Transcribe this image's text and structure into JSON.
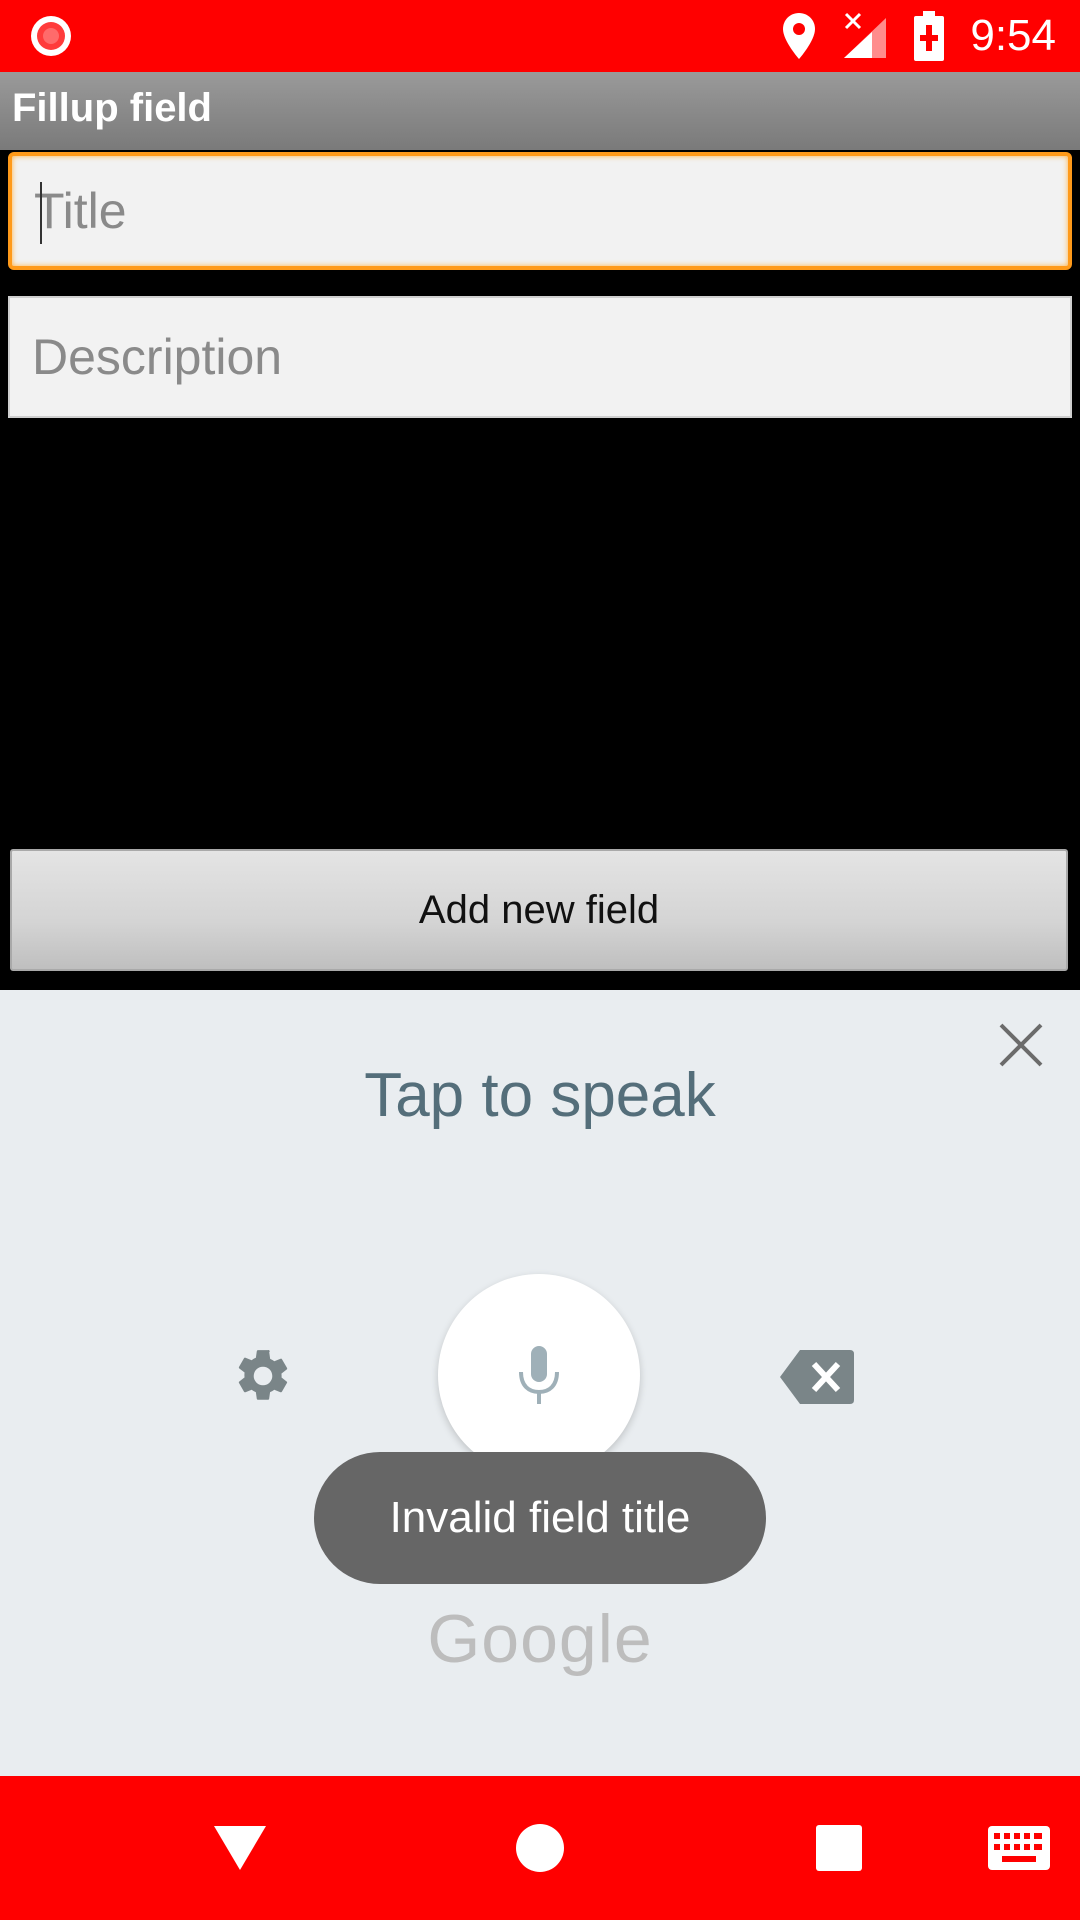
{
  "status_bar": {
    "time": "9:54",
    "icons": [
      "record-icon",
      "location-icon",
      "signal-off-icon",
      "battery-charging-icon"
    ],
    "color": "#ff0000"
  },
  "app": {
    "title": "Fillup field"
  },
  "form": {
    "title_placeholder": "Title",
    "title_value": "",
    "description_placeholder": "Description",
    "description_value": "",
    "add_button_label": "Add new field"
  },
  "voice_input": {
    "prompt": "Tap to speak",
    "branding": "Google",
    "icons": [
      "close-icon",
      "settings-gear-icon",
      "microphone-icon",
      "backspace-icon"
    ]
  },
  "toast": {
    "message": "Invalid field title"
  },
  "nav_bar": {
    "icons": [
      "back-icon",
      "home-icon",
      "recents-icon",
      "keyboard-icon"
    ],
    "color": "#ff0000"
  }
}
